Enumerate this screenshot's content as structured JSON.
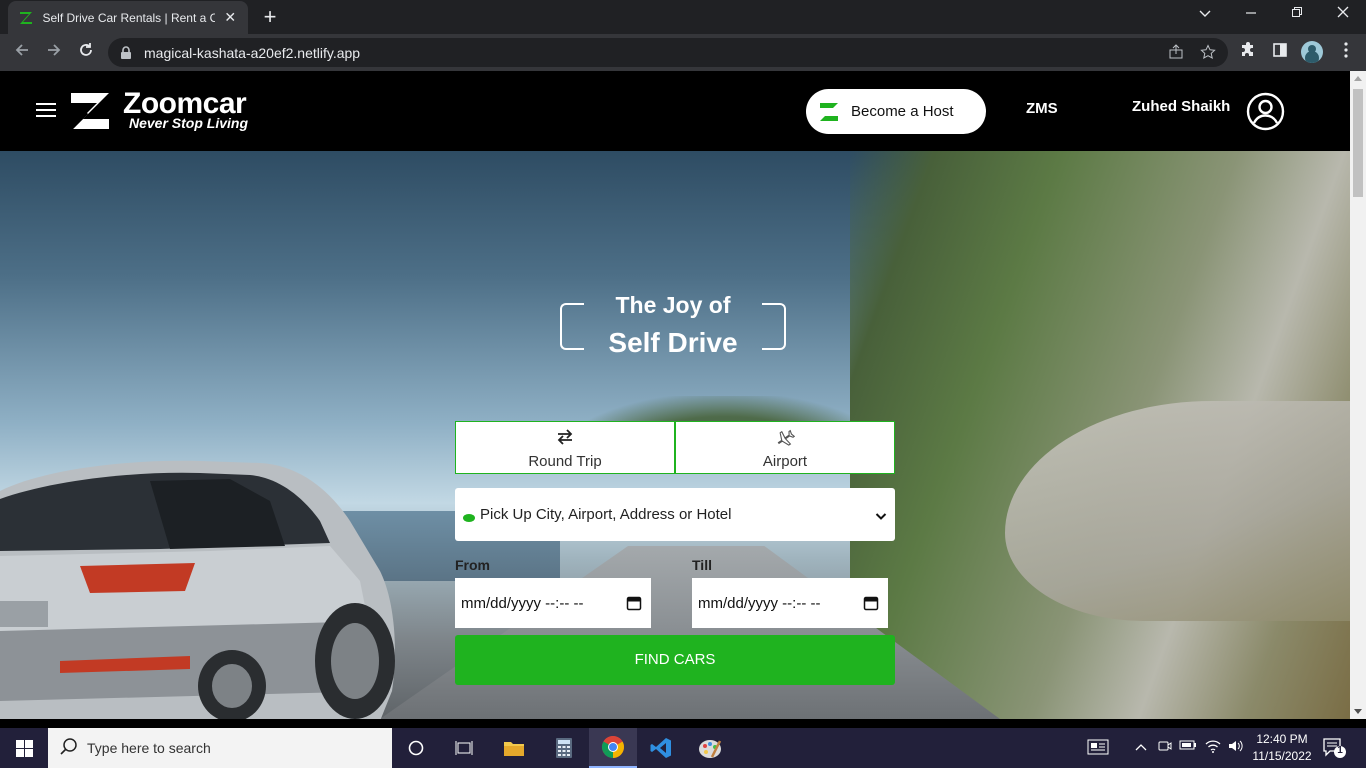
{
  "browser": {
    "tab_title": "Self Drive Car Rentals | Rent a Car",
    "url": "magical-kashata-a20ef2.netlify.app",
    "new_tab_label": "+",
    "close_label": "✕"
  },
  "header": {
    "brand_name": "Zoomcar",
    "brand_tagline": "Never Stop Living",
    "host_button": "Become a Host",
    "zms_link": "ZMS",
    "user_name": "Zuhed Shaikh"
  },
  "hero": {
    "tagline_line1": "The Joy of",
    "tagline_line2": "Self Drive"
  },
  "booking": {
    "trip_tabs": [
      {
        "label": "Round Trip",
        "icon": "swap-arrows-icon"
      },
      {
        "label": "Airport",
        "icon": "airplane-icon"
      }
    ],
    "pickup_placeholder": "Pick Up City, Airport, Address or Hotel",
    "from_label": "From",
    "till_label": "Till",
    "from_value": "mm/dd/yyyy --:-- --",
    "till_value": "mm/dd/yyyy --:-- --",
    "find_button": "FIND CARS"
  },
  "taskbar": {
    "search_placeholder": "Type here to search",
    "time": "12:40 PM",
    "date": "11/15/2022",
    "notification_count": "1"
  },
  "colors": {
    "brand_green": "#1fb31f",
    "header_bg": "#000000",
    "taskbar_bg": "#22203a"
  }
}
